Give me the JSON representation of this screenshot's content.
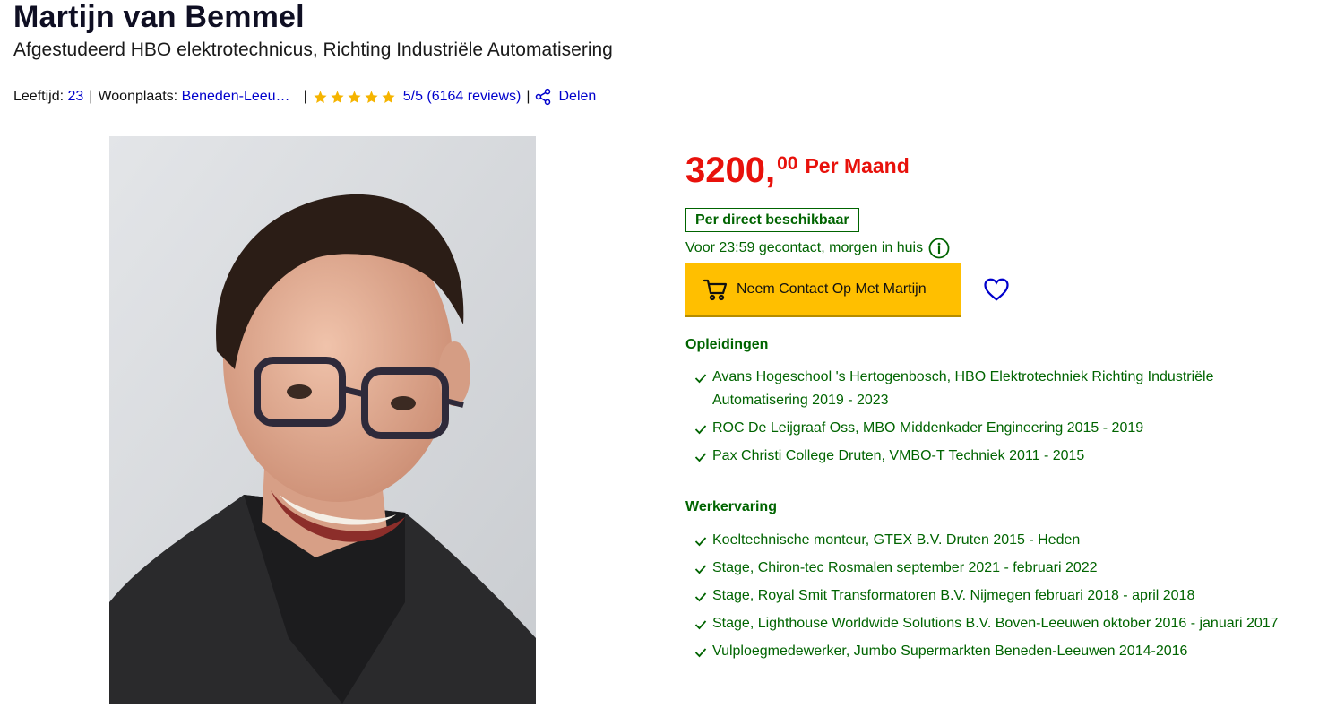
{
  "header": {
    "name": "Martijn van Bemmel",
    "subtitle": "Afgestudeerd HBO elektrotechnicus, Richting Industriële Automatisering"
  },
  "meta": {
    "age_label": "Leeftijd:",
    "age_value": "23",
    "separator": "|",
    "city_label": "Woonplaats:",
    "city_value": "Beneden-Leeuwen",
    "rating_stars": 5,
    "rating_text": "5/5 (6164 reviews)",
    "share_label": "Delen"
  },
  "offer": {
    "price_main": "3200,",
    "price_cents": "00",
    "price_period": "Per Maand",
    "availability": "Per direct beschikbaar",
    "delivery": "Voor 23:59 gecontact, morgen in huis",
    "cta_label": "Neem Contact Op Met Martijn"
  },
  "education": {
    "title": "Opleidingen",
    "items": [
      "Avans Hogeschool 's Hertogenbosch, HBO Elektrotechniek Richting Industriële Automatisering 2019 - 2023",
      "ROC De Leijgraaf Oss, MBO Middenkader Engineering 2015 - 2019",
      "Pax Christi College Druten, VMBO-T Techniek 2011 - 2015"
    ]
  },
  "experience": {
    "title": "Werkervaring",
    "items": [
      "Koeltechnische monteur, GTEX B.V. Druten 2015 - Heden",
      "Stage, Chiron-tec Rosmalen september 2021 - februari 2022",
      "Stage, Royal Smit Transformatoren B.V. Nijmegen februari 2018 - april 2018",
      "Stage, Lighthouse Worldwide Solutions B.V. Boven-Leeuwen oktober 2016 - januari 2017",
      "Vulploegmedewerker, Jumbo Supermarkten Beneden-Leeuwen 2014-2016"
    ]
  },
  "colors": {
    "price": "#e8110b",
    "green": "#006400",
    "cta": "#ffbf00",
    "link": "#0000cc",
    "star": "#f5b400"
  },
  "icons": {
    "star": "star-icon",
    "share": "share-icon",
    "info": "info-icon",
    "cart": "cart-icon",
    "heart": "heart-icon",
    "check": "check-icon"
  }
}
